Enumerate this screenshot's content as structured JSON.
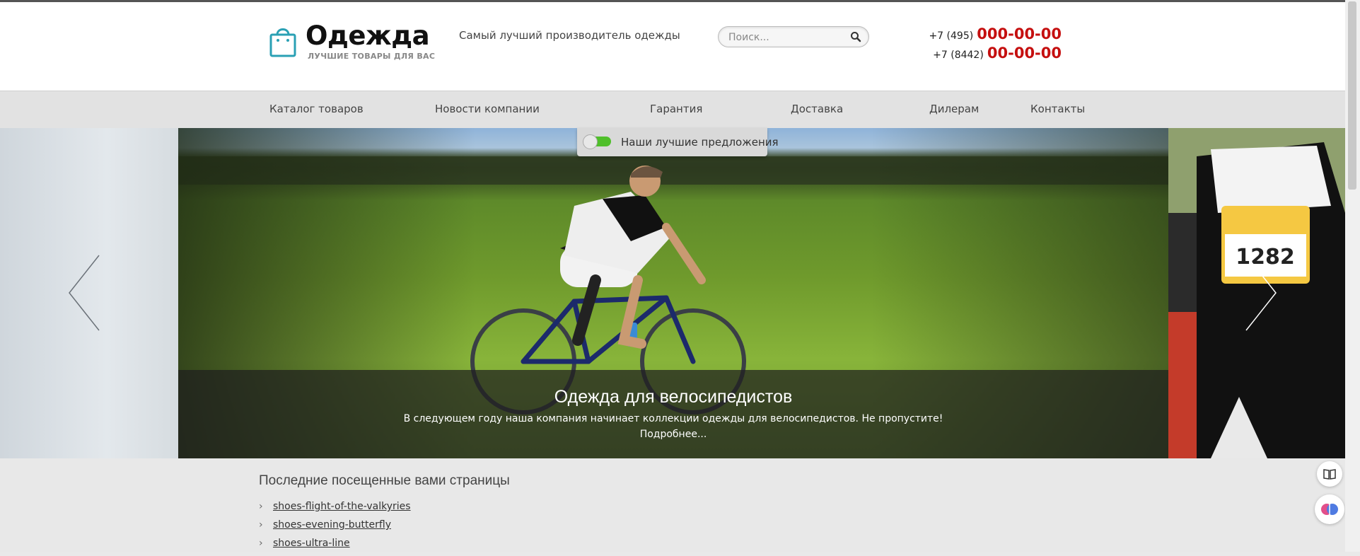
{
  "header": {
    "logo_title": "Одежда",
    "logo_subtitle": "ЛУЧШИЕ ТОВАРЫ ДЛЯ ВАС",
    "tagline": "Самый лучший производитель одежды",
    "search_placeholder": "Поиск...",
    "phones": [
      {
        "code": "+7 (495)",
        "number": "000-00-00"
      },
      {
        "code": "+7 (8442)",
        "number": "00-00-00"
      }
    ]
  },
  "nav": {
    "items": [
      {
        "label": "Каталог товаров"
      },
      {
        "label": "Новости компании"
      },
      {
        "label": "Гарантия"
      },
      {
        "label": "Доставка"
      },
      {
        "label": "Дилерам"
      },
      {
        "label": "Контакты"
      }
    ]
  },
  "slider": {
    "banner_label": "Наши лучшие предложения",
    "caption_title": "Одежда для велосипедистов",
    "caption_text": "В следующем году наша компания начинает коллекции одежды для велосипедистов. Не пропустите!",
    "caption_more": "Подробнее...",
    "right_bib_number": "1282"
  },
  "recent": {
    "title": "Последние посещенные вами страницы",
    "chevron": "›",
    "links": [
      {
        "label": "shoes-flight-of-the-valkyries"
      },
      {
        "label": "shoes-evening-butterfly"
      },
      {
        "label": "shoes-ultra-line"
      }
    ]
  },
  "colors": {
    "accent_phone": "#c50f0f",
    "logo_bag": "#2aa0b4",
    "toggle_green": "#4fbf2a"
  },
  "icons": [
    "shopping-bag-icon",
    "search-icon",
    "prev-arrow-icon",
    "next-arrow-icon",
    "book-icon",
    "brain-icon"
  ]
}
